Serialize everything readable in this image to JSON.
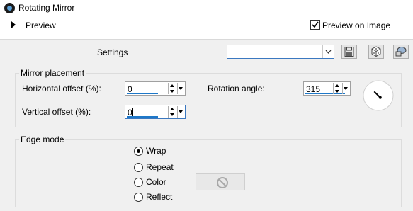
{
  "window": {
    "title": "Rotating Mirror"
  },
  "preview": {
    "label": "Preview",
    "preview_on_image_label": "Preview on Image",
    "preview_on_image_checked": true
  },
  "settings": {
    "label": "Settings",
    "preset_value": ""
  },
  "mirror_placement": {
    "title": "Mirror placement",
    "horizontal_offset": {
      "label": "Horizontal offset (%):",
      "value": "0"
    },
    "vertical_offset": {
      "label": "Vertical offset (%):",
      "value": "0"
    },
    "rotation_angle": {
      "label": "Rotation angle:",
      "value": "315",
      "degrees": 315
    }
  },
  "edge_mode": {
    "title": "Edge mode",
    "options": [
      "Wrap",
      "Repeat",
      "Color",
      "Reflect"
    ],
    "selected": "Wrap"
  },
  "icons": [
    "app-icon",
    "expand-triangle-icon",
    "save-preset-icon",
    "randomize-dice-icon",
    "reset-defaults-icon",
    "disabled-icon"
  ],
  "colors": {
    "accent": "#1e78c8",
    "panel_bg": "#f0f0f0"
  }
}
